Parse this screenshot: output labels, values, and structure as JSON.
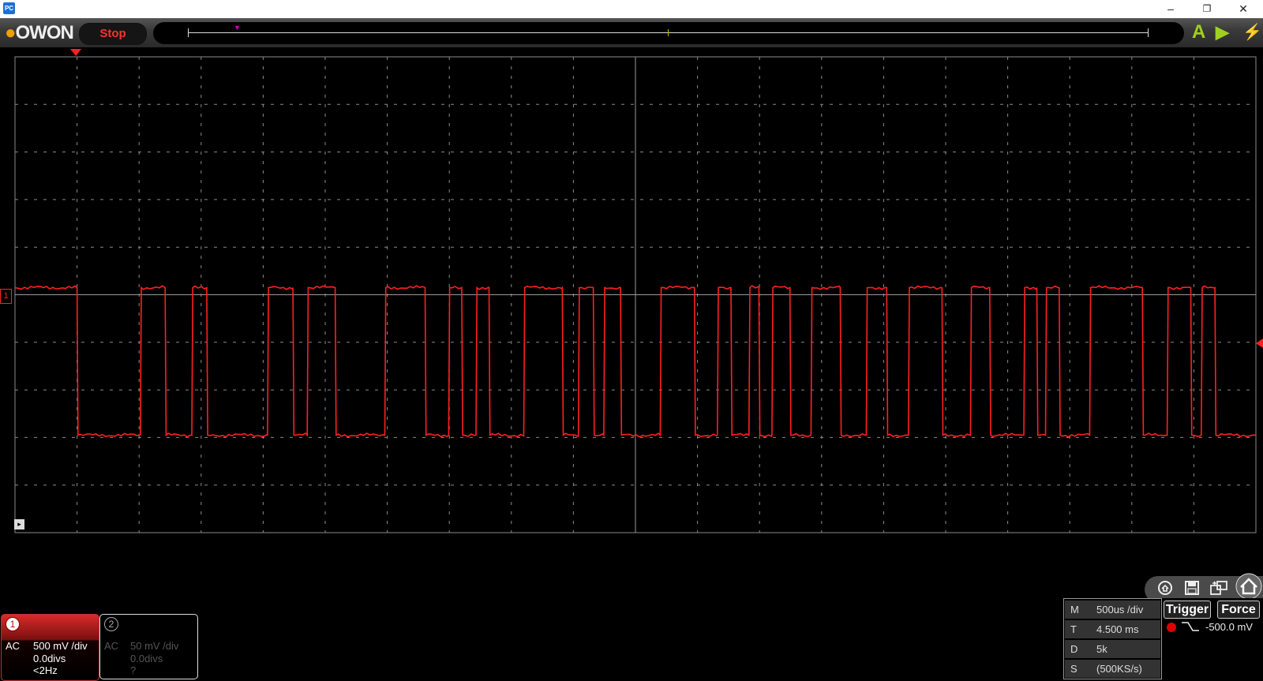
{
  "titlebar": {
    "app_icon": "PC",
    "minimize": "–",
    "restore": "❐",
    "close": "✕"
  },
  "toolbar": {
    "logo": "OWON",
    "run_state": "Stop",
    "icons": [
      "auto-icon",
      "run-icon",
      "force-icon"
    ],
    "auto_glyph": "A",
    "run_glyph": "▶",
    "force_glyph": "⚡",
    "accent_color": "#a0d020"
  },
  "screen": {
    "grid_color": "#8a8a8a",
    "trace_color": "#ff2020",
    "h_divisions": 20,
    "v_divisions": 10,
    "ch1_marker": "1",
    "waveform": {
      "high_div": 0.15,
      "low_div": -2.95,
      "transitions_div": [
        1.0,
        2.02,
        2.42,
        2.85,
        3.09,
        4.07,
        4.48,
        4.71,
        5.16,
        5.96,
        6.61,
        6.99,
        7.2,
        7.43,
        7.64,
        8.2,
        8.82,
        9.08,
        9.32,
        9.49,
        9.76,
        10.4,
        10.95,
        11.32,
        11.54,
        11.83,
        11.99,
        12.2,
        12.49,
        12.83,
        13.3,
        13.72,
        14.05,
        14.4,
        14.94,
        15.4,
        15.71,
        16.26,
        16.47,
        16.61,
        16.83,
        17.32,
        18.17,
        18.57,
        18.95,
        19.12,
        19.34,
        20.0
      ],
      "start_level": "high"
    }
  },
  "nav": {
    "icons": [
      "auto-setup-icon",
      "save-icon",
      "window-icon",
      "home-icon"
    ],
    "glyphs": [
      "⌂",
      "💾",
      "⇄",
      "⌂"
    ]
  },
  "ch1": {
    "number": "1",
    "coupling": "AC",
    "scale": "500 mV /div",
    "offset": "0.0divs",
    "freq": "<2Hz",
    "color": "#ff2020"
  },
  "ch2": {
    "number": "2",
    "coupling": "AC",
    "scale": "50 mV /div",
    "offset": "0.0divs",
    "freq": "?"
  },
  "timebase": {
    "rows": [
      {
        "key": "M",
        "value": "500us /div"
      },
      {
        "key": "T",
        "value": "4.500 ms"
      },
      {
        "key": "D",
        "value": "5k"
      },
      {
        "key": "S",
        "value": "(500KS/s)"
      }
    ]
  },
  "trigger": {
    "trigger_label": "Trigger",
    "force_label": "Force",
    "source": "1",
    "slope": "falling",
    "level": "-500.0 mV"
  }
}
